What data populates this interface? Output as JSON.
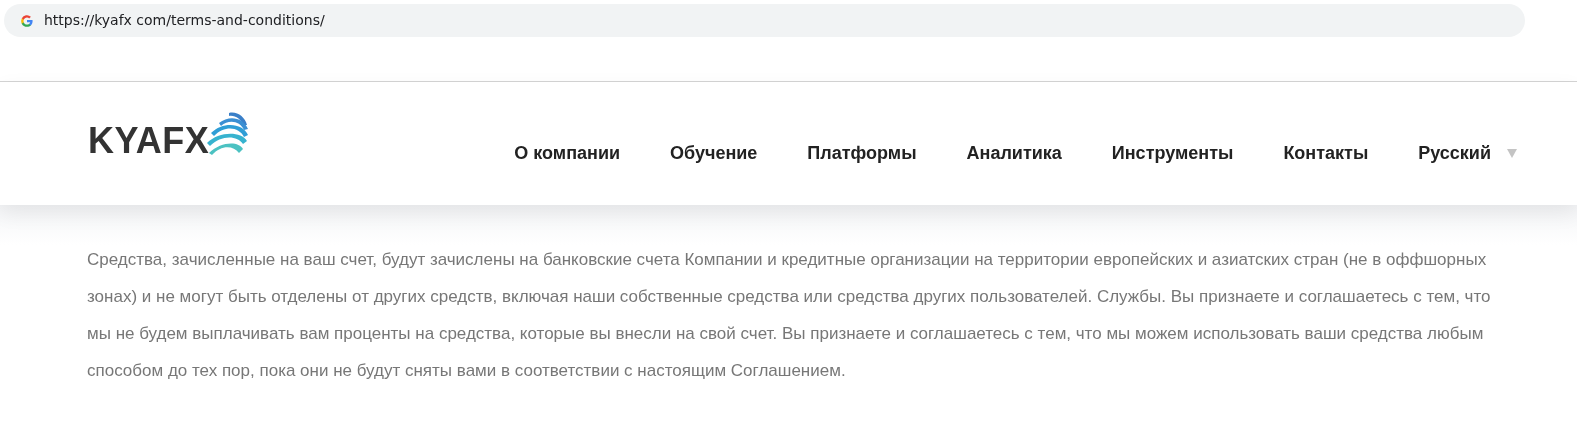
{
  "browser": {
    "url": "https://kyafx com/terms-and-conditions/"
  },
  "header": {
    "logo": "KYAFX",
    "nav": [
      {
        "label": "О компании"
      },
      {
        "label": "Обучение"
      },
      {
        "label": "Платформы"
      },
      {
        "label": "Аналитика"
      },
      {
        "label": "Инструменты"
      },
      {
        "label": "Контакты"
      },
      {
        "label": "Русский",
        "kind": "dropdown"
      }
    ]
  },
  "content": {
    "paragraph": "Средства, зачисленные на ваш счет, будут зачислены на банковские счета Компании и кредитные организации на территории европейских и азиатских стран (не в оффшорных зонах) и не могут быть отделены от других средств, включая наши собственные средства или средства других пользователей. Службы. Вы признаете и соглашаетесь с тем, что мы не будем выплачивать вам проценты на средства, которые вы внесли на свой счет. Вы признаете и соглашаетесь с тем, что мы можем использовать ваши средства любым способом до тех пор, пока они не будут сняты вами в соответствии с настоящим Соглашением."
  }
}
